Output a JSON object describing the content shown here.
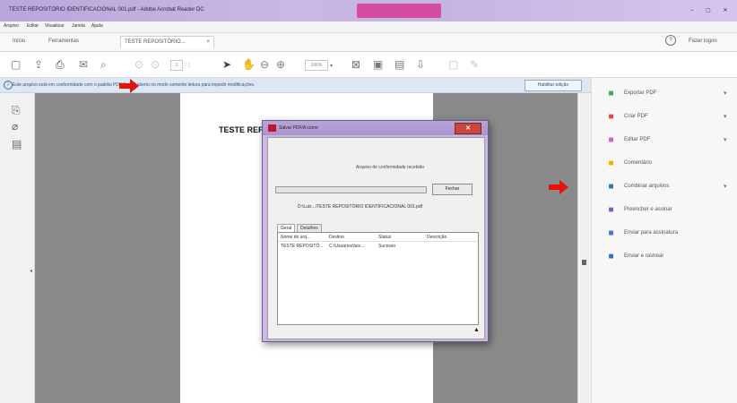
{
  "titlebar": {
    "title": "TESTE REPOSITÓRIO IDENTIFICACIONAL 001.pdf - Adobe Acrobat Reader DC",
    "win_buttons": "– ▢ ✕"
  },
  "menu": [
    "Arquivo",
    "Editar",
    "Visualizar",
    "Janela",
    "Ajuda"
  ],
  "tabs": {
    "home": "Início",
    "tools": "Ferramentas",
    "doc": "TESTE REPOSITÓRIO...",
    "doc_close": "×",
    "help_glyph": "?",
    "signin": "Fazer logon"
  },
  "toolbar": {
    "page_field": "1",
    "page_total": "/ 1",
    "zoom": "106%",
    "zoom_arrow": "▾"
  },
  "infobar": {
    "icon": "i",
    "message": "Este arquivo está em conformidade com o padrão PDF/A e foi aberto no modo somente leitura para impedir modificações.",
    "button": "Habilitar edição"
  },
  "document": {
    "heading": "TESTE REPOSITÓRIO"
  },
  "dialog": {
    "title": "Salvar PDF/A como",
    "close": "✕",
    "status": "Arquivo de conformidade recebido",
    "button_close": "Fechar",
    "file_path": "D:\\Luiz...\\TESTE REPOSITÓRIO IDENTIFICACIONAL 001.pdf",
    "tabs": [
      "Geral",
      "Detalhes"
    ],
    "columns": [
      "Nome do arq...",
      "Destino",
      "Status",
      "Descrição"
    ],
    "rows": [
      [
        "TESTE REPOSITÓ...",
        "C:\\Usuarios\\luiz...",
        "Sucesso",
        ""
      ]
    ],
    "more": "▲"
  },
  "rightpane": {
    "items": [
      {
        "label": "Exportar PDF",
        "icon": "export-pdf-icon",
        "color": "#3aa857",
        "chevron": true
      },
      {
        "label": "Criar PDF",
        "icon": "create-pdf-icon",
        "color": "#e34850",
        "chevron": true
      },
      {
        "label": "Editar PDF",
        "icon": "edit-pdf-icon",
        "color": "#d05fd5",
        "chevron": true
      },
      {
        "label": "Comentário",
        "icon": "comment-icon",
        "color": "#f0b400",
        "chevron": false
      },
      {
        "label": "Combinar arquivos",
        "icon": "combine-files-icon",
        "color": "#2d6fd2",
        "chevron": true
      },
      {
        "label": "Preencher e assinar",
        "icon": "fill-sign-icon",
        "color": "#7b5ec9",
        "chevron": false
      },
      {
        "label": "Enviar para assinatura",
        "icon": "send-signature-icon",
        "color": "#4f6fd6",
        "chevron": false
      },
      {
        "label": "Enviar e rastrear",
        "icon": "send-track-icon",
        "color": "#2d6fd2",
        "chevron": false
      }
    ],
    "chevron_glyph": "▾",
    "item_glyph": "■"
  },
  "colors": {
    "annotation_arrow": "#e8100a",
    "doc_bg": "#8a8a8a"
  }
}
